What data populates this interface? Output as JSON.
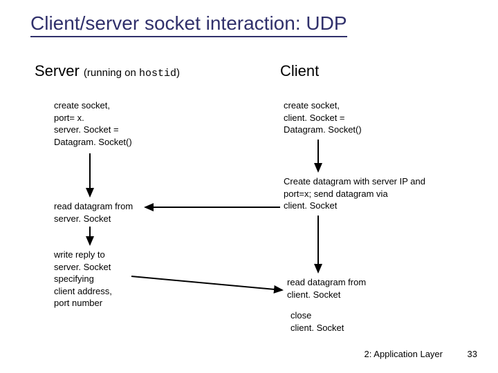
{
  "title": "Client/server socket interaction: UDP",
  "headings": {
    "server": "Server",
    "server_sub_open": "(running on ",
    "server_sub_host": "hostid",
    "server_sub_close": ")",
    "client": "Client"
  },
  "server_steps": {
    "create_l1": "create socket,",
    "create_l2": "port= x.",
    "create_l3": "server. Socket =",
    "create_l4": "Datagram. Socket()",
    "read_l1": "read datagram from",
    "read_l2": "server. Socket",
    "write_l1": "write reply to",
    "write_l2": "server. Socket",
    "write_l3": "specifying",
    "write_l4": "client address,",
    "write_l5": "port number"
  },
  "client_steps": {
    "create_l1": "create socket,",
    "create_l2": "client. Socket =",
    "create_l3": "Datagram. Socket()",
    "send_l1": "Create datagram with server IP and",
    "send_l2": "port=x; send datagram via",
    "send_l3": "client. Socket",
    "read_l1": "read datagram from",
    "read_l2": "client. Socket",
    "close_l1": "close",
    "close_l2": "client. Socket"
  },
  "footer": {
    "label": "2: Application Layer",
    "page": "33"
  }
}
